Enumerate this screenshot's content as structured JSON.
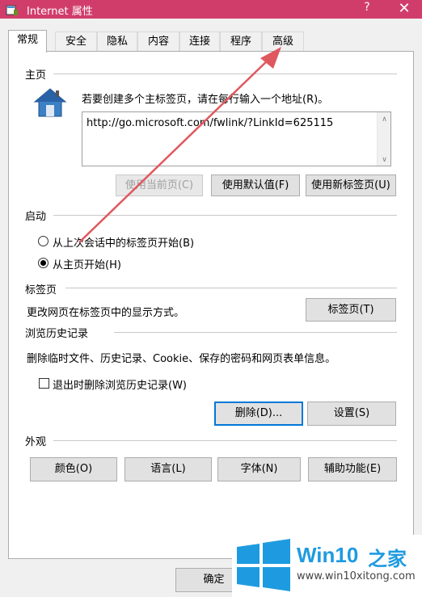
{
  "window": {
    "title": "Internet 属性",
    "help_label": "?",
    "close_label": "✕"
  },
  "tabs": [
    {
      "label": "常规",
      "active": true
    },
    {
      "label": "安全"
    },
    {
      "label": "隐私"
    },
    {
      "label": "内容"
    },
    {
      "label": "连接"
    },
    {
      "label": "程序"
    },
    {
      "label": "高级"
    }
  ],
  "homepage": {
    "title": "主页",
    "instruction": "若要创建多个主标签页，请在每行输入一个地址(R)。",
    "url": "http://go.microsoft.com/fwlink/?LinkId=625115",
    "btn_current": "使用当前页(C)",
    "btn_default": "使用默认值(F)",
    "btn_newtab": "使用新标签页(U)"
  },
  "startup": {
    "title": "启动",
    "option_last": "从上次会话中的标签页开始(B)",
    "option_home": "从主页开始(H)",
    "selected": "home"
  },
  "tabs_section": {
    "title": "标签页",
    "description": "更改网页在标签页中的显示方式。",
    "btn_tabs": "标签页(T)"
  },
  "history": {
    "title": "浏览历史记录",
    "description": "删除临时文件、历史记录、Cookie、保存的密码和网页表单信息。",
    "checkbox_label": "退出时删除浏览历史记录(W)",
    "checked": false,
    "btn_delete": "删除(D)...",
    "btn_settings": "设置(S)"
  },
  "appearance": {
    "title": "外观",
    "btn_colors": "颜色(O)",
    "btn_languages": "语言(L)",
    "btn_fonts": "字体(N)",
    "btn_accessibility": "辅助功能(E)"
  },
  "footer": {
    "btn_ok": "确定"
  },
  "watermark": {
    "brand_win": "Win10",
    "brand_suffix": "之家",
    "url": "www.win10xitong.com"
  },
  "colors": {
    "titlebar": "#d13d6b",
    "annotation_arrow": "#e0585f",
    "win_logo": "#1e9be0"
  }
}
